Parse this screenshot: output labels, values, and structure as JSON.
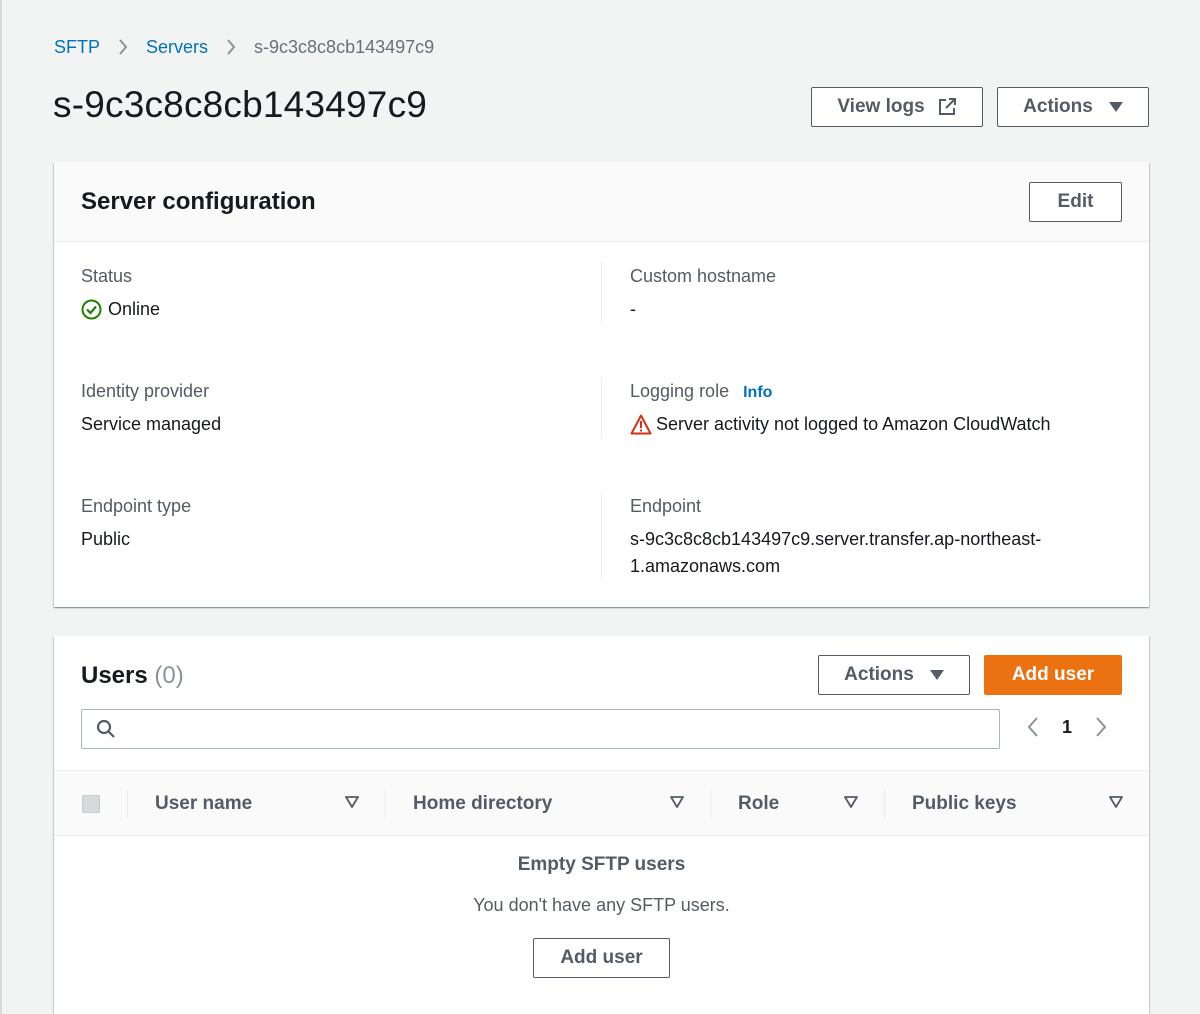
{
  "breadcrumb": {
    "items": [
      "SFTP",
      "Servers"
    ],
    "current": "s-9c3c8c8cb143497c9"
  },
  "header": {
    "title": "s-9c3c8c8cb143497c9",
    "view_logs_label": "View logs",
    "actions_label": "Actions"
  },
  "server_config": {
    "title": "Server configuration",
    "edit_label": "Edit",
    "status_label": "Status",
    "status_value": "Online",
    "custom_hostname_label": "Custom hostname",
    "custom_hostname_value": "-",
    "identity_provider_label": "Identity provider",
    "identity_provider_value": "Service managed",
    "logging_role_label": "Logging role",
    "logging_role_info": "Info",
    "logging_role_value": "Server activity not logged to Amazon CloudWatch",
    "endpoint_type_label": "Endpoint type",
    "endpoint_type_value": "Public",
    "endpoint_label": "Endpoint",
    "endpoint_value_line1": "s-9c3c8c8cb143497c9.server.transfer.ap-northeast-",
    "endpoint_value_line2": "1.amazonaws.com"
  },
  "users": {
    "title": "Users",
    "count": "(0)",
    "actions_label": "Actions",
    "add_user_label": "Add user",
    "search_placeholder": "",
    "page_number": "1",
    "columns": [
      "User name",
      "Home directory",
      "Role",
      "Public keys"
    ],
    "empty_title": "Empty SFTP users",
    "empty_text": "You don't have any SFTP users.",
    "empty_add_user_label": "Add user"
  },
  "colors": {
    "link": "#0073bb",
    "primary": "#ec7211",
    "success": "#1d8102",
    "warning": "#d13212"
  },
  "icons": {
    "external_link": "external-link-icon",
    "caret": "caret-down-icon",
    "status_ok": "status-check-icon",
    "warning": "warning-icon",
    "search": "search-icon",
    "chevron_left": "chevron-left-icon",
    "chevron_right": "chevron-right-icon",
    "sort": "sort-icon"
  }
}
